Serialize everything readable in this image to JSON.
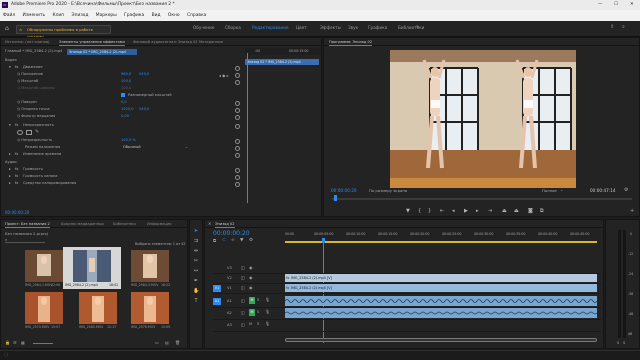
{
  "app": {
    "title": "Adobe Premiere Pro 2020 - E:\\Всячина\\Фильмы\\Проект\\Без названия 2 *",
    "window_controls": {
      "minimize": "—",
      "maximize": "☐",
      "close": "✕"
    }
  },
  "menu": [
    "Файл",
    "Изменить",
    "Клип",
    "Эпизод",
    "Маркеры",
    "Графика",
    "Вид",
    "Окно",
    "Справка"
  ],
  "workspaces": {
    "home_icon": "home-icon",
    "items": [
      "Обучение",
      "Сборка",
      "Редактирование",
      "Цвет",
      "Эффекты",
      "Звук",
      "Графика",
      "Библиотеки"
    ],
    "active_index": 2,
    "warning": "Обнаружены проблемы в работе системы"
  },
  "effect_controls": {
    "tabs": [
      "Источник: (нет клипов)",
      "Элементы управления эффектами",
      "Фоновый аудиосигнал: Эпизод 02",
      "Метаданные"
    ],
    "active_tab": 1,
    "master_label": "Главный * IMG_2584-2 (2).mp4",
    "clip_label": "Эпизод 02 * IMG_2584-2 (2).mp4",
    "video_header": "Видео",
    "motion": "Движение",
    "rows": [
      {
        "name": "Положение",
        "v1": "960,0",
        "v2": "540,0"
      },
      {
        "name": "Масштаб",
        "v1": "100,0",
        "v2": ""
      },
      {
        "name": "Масштаб ширины",
        "v1": "100,0",
        "v2": ""
      },
      {
        "name": "Поворот",
        "v1": "0,0",
        "v2": ""
      },
      {
        "name": "Опорная точка",
        "v1": "1920,0",
        "v2": "540,0"
      },
      {
        "name": "Фильтр мерцания",
        "v1": "0,00",
        "v2": ""
      }
    ],
    "uniform_scale": "Равномерный масштаб",
    "opacity": "Непрозрачность",
    "opacity_row": {
      "name": "Непрозрачность",
      "value": "100,0 %"
    },
    "blend_mode": {
      "name": "Режим наложения",
      "value": "Обычный"
    },
    "time_remap": "Изменение времени",
    "audio_header": "Аудио",
    "audio_rows": [
      "Громкость",
      "Громкость канала",
      "Средство панорамирования"
    ],
    "timecode": "00:00:00:20",
    "ruler_timecode": "00:00:15:00"
  },
  "program_monitor": {
    "tab": "Программа: Эпизод 02",
    "timecode": "00:00:00:20",
    "fit": "По размеру экрана",
    "quality": "Полное",
    "duration": "00:00:47:14"
  },
  "project": {
    "tabs": [
      "Проект: Без названия 2",
      "Браузер медиаданных",
      "Библиотеки",
      "Информация"
    ],
    "file": "Без названия 2.prproj",
    "selection": "Выбрано элементов: 1 из 42",
    "items": [
      {
        "name": "IMG_2584-1.MOV",
        "dur": "12:06"
      },
      {
        "name": "IMG_2584-2 (2).mp4",
        "dur": "18:02"
      },
      {
        "name": "IMG_2584-3.MOV",
        "dur": "16:22"
      },
      {
        "name": "IMG_2570.MOV",
        "dur": "15:07"
      },
      {
        "name": "IMG_2580.MOV",
        "dur": "12:17"
      },
      {
        "name": "IMG_2576.MOV",
        "dur": "15:09"
      }
    ]
  },
  "timeline": {
    "tab": "Эпизод 02",
    "timecode": "00:00:00:20",
    "ruler": [
      "00:00",
      "00:00:05:00",
      "00:00:10:00",
      "00:00:15:00",
      "00:00:20:00",
      "00:00:25:00",
      "00:00:30:00",
      "00:00:35:00",
      "00:00:40:00",
      "00:00:45:00"
    ],
    "video_tracks": [
      "V3",
      "V2",
      "V1"
    ],
    "audio_tracks": [
      "A1",
      "A2",
      "A3"
    ],
    "clips": [
      "IMG_2584-2 (2).mp4 [V]",
      "IMG_2584-2 (2).mp4 [V]"
    ],
    "meter_labels": [
      "0",
      "-12",
      "-24",
      "-36",
      "-48",
      "dB"
    ]
  },
  "colors": {
    "accent": "#2d8ceb",
    "clip_video": "#93b9e0",
    "clip_audio": "#79a6d1",
    "warning": "#e7b23a"
  }
}
